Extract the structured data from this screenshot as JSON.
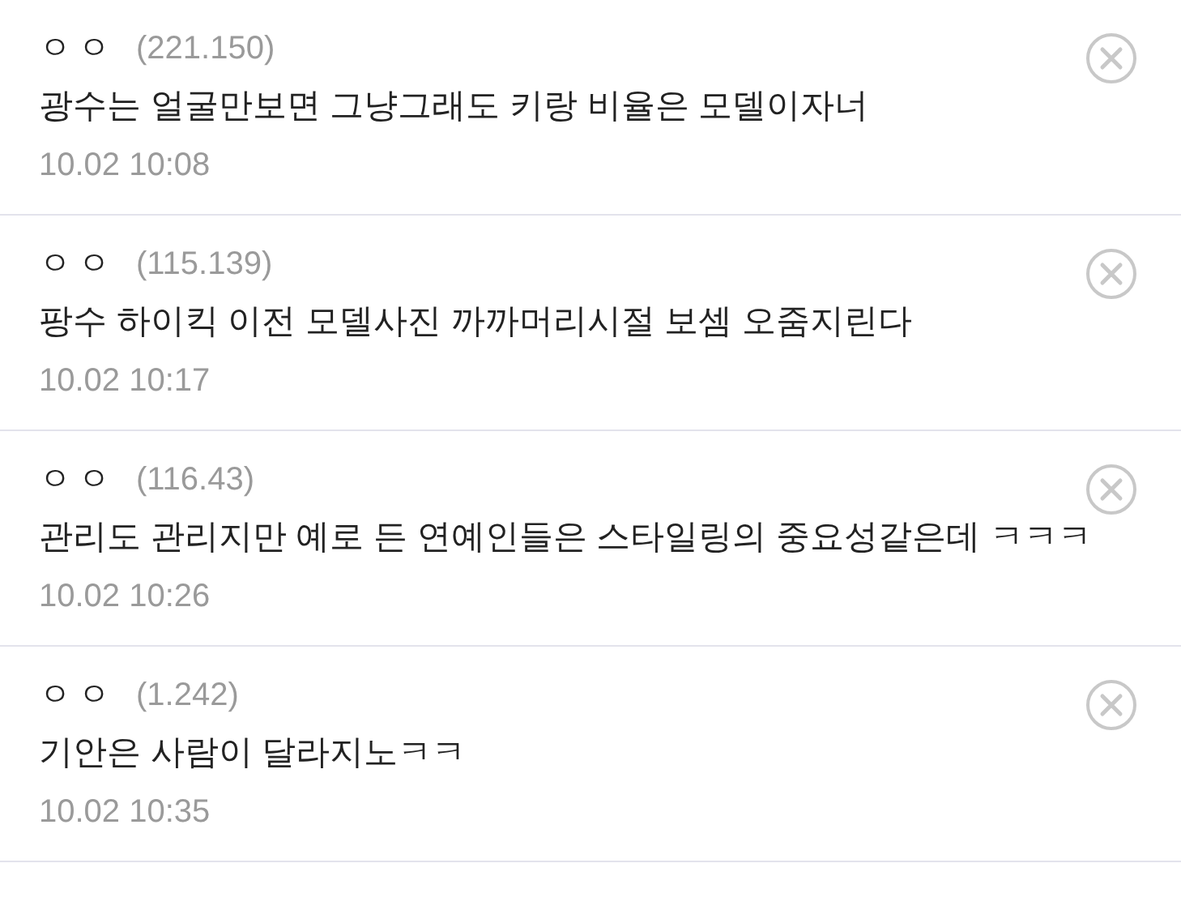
{
  "comments": [
    {
      "author": "ㅇㅇ",
      "ip": "(221.150)",
      "text": "광수는 얼굴만보면 그냥그래도 키랑 비율은 모델이자너",
      "date": "10.02 10:08"
    },
    {
      "author": "ㅇㅇ",
      "ip": "(115.139)",
      "text": "팡수 하이킥 이전 모델사진 까까머리시절 보셈 오줌지린다",
      "date": "10.02 10:17"
    },
    {
      "author": "ㅇㅇ",
      "ip": "(116.43)",
      "text": "관리도 관리지만 예로 든 연예인들은 스타일링의 중요성같은데 ㅋㅋㅋ",
      "date": "10.02 10:26"
    },
    {
      "author": "ㅇㅇ",
      "ip": "(1.242)",
      "text": "기안은 사람이 달라지노ㅋㅋ",
      "date": "10.02 10:35"
    }
  ]
}
